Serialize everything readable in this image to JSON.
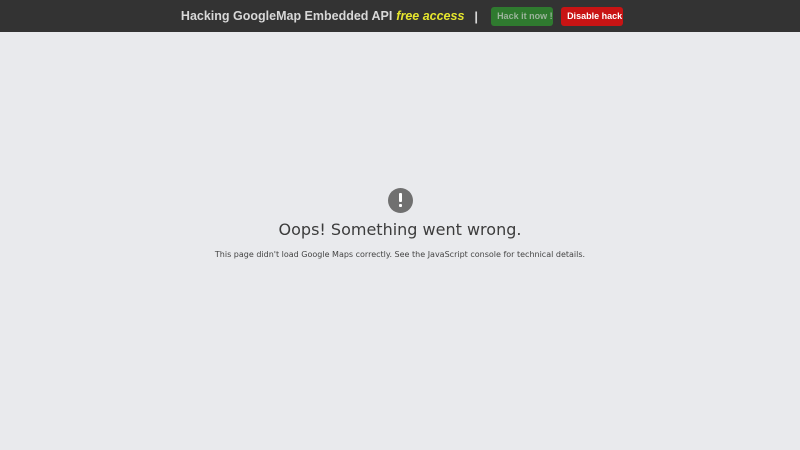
{
  "header": {
    "title": "Hacking GoogleMap Embedded API",
    "title_highlight": "free access",
    "separator": "|",
    "hack_button_label": "Hack it now !",
    "disable_button_label": "Disable hack"
  },
  "error": {
    "icon": "exclamation-icon",
    "title": "Oops! Something went wrong.",
    "detail": "This page didn't load Google Maps correctly. See the JavaScript console for technical details."
  },
  "colors": {
    "header_bg": "#333333",
    "highlight": "#e6e62e",
    "hack_button_bg": "#2f7a2f",
    "disable_button_bg": "#c81414",
    "page_bg": "#e9eaed"
  }
}
